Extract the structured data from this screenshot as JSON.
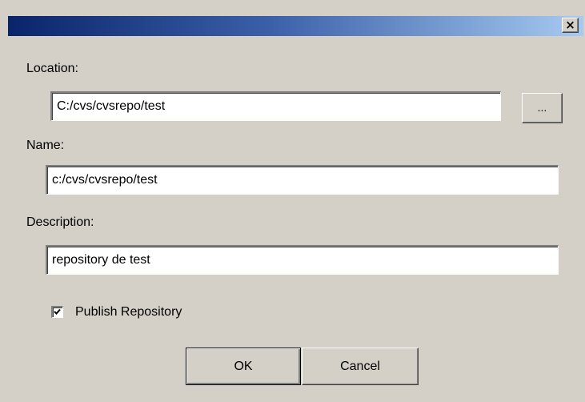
{
  "dialog": {
    "close_glyph": "×",
    "location": {
      "label": "Location:",
      "value": "C:/cvs/cvsrepo/test",
      "browse_label": "..."
    },
    "name": {
      "label": "Name:",
      "value": "c:/cvs/cvsrepo/test"
    },
    "description": {
      "label": "Description:",
      "value": "repository de test"
    },
    "publish": {
      "label": "Publish Repository",
      "checked": true
    },
    "buttons": {
      "ok": "OK",
      "cancel": "Cancel"
    }
  },
  "colors": {
    "title_gradient_start": "#0a246a",
    "title_gradient_end": "#a6caf0",
    "face": "#d4d0c8"
  }
}
